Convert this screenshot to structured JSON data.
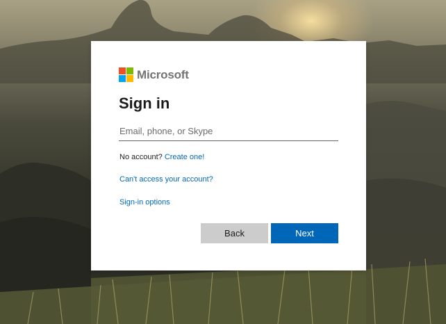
{
  "brand": {
    "name": "Microsoft",
    "colors": {
      "red": "#f25022",
      "green": "#7fba00",
      "blue": "#00a4ef",
      "yellow": "#ffb900"
    }
  },
  "signin": {
    "title": "Sign in",
    "input_placeholder": "Email, phone, or Skype",
    "input_value": "",
    "no_account_text": "No account?",
    "create_link": "Create one!",
    "cant_access_link": "Can't access your account?",
    "options_link": "Sign-in options"
  },
  "buttons": {
    "back_label": "Back",
    "next_label": "Next"
  },
  "theme": {
    "accent": "#0067b8",
    "secondary_button": "#cccccc"
  }
}
